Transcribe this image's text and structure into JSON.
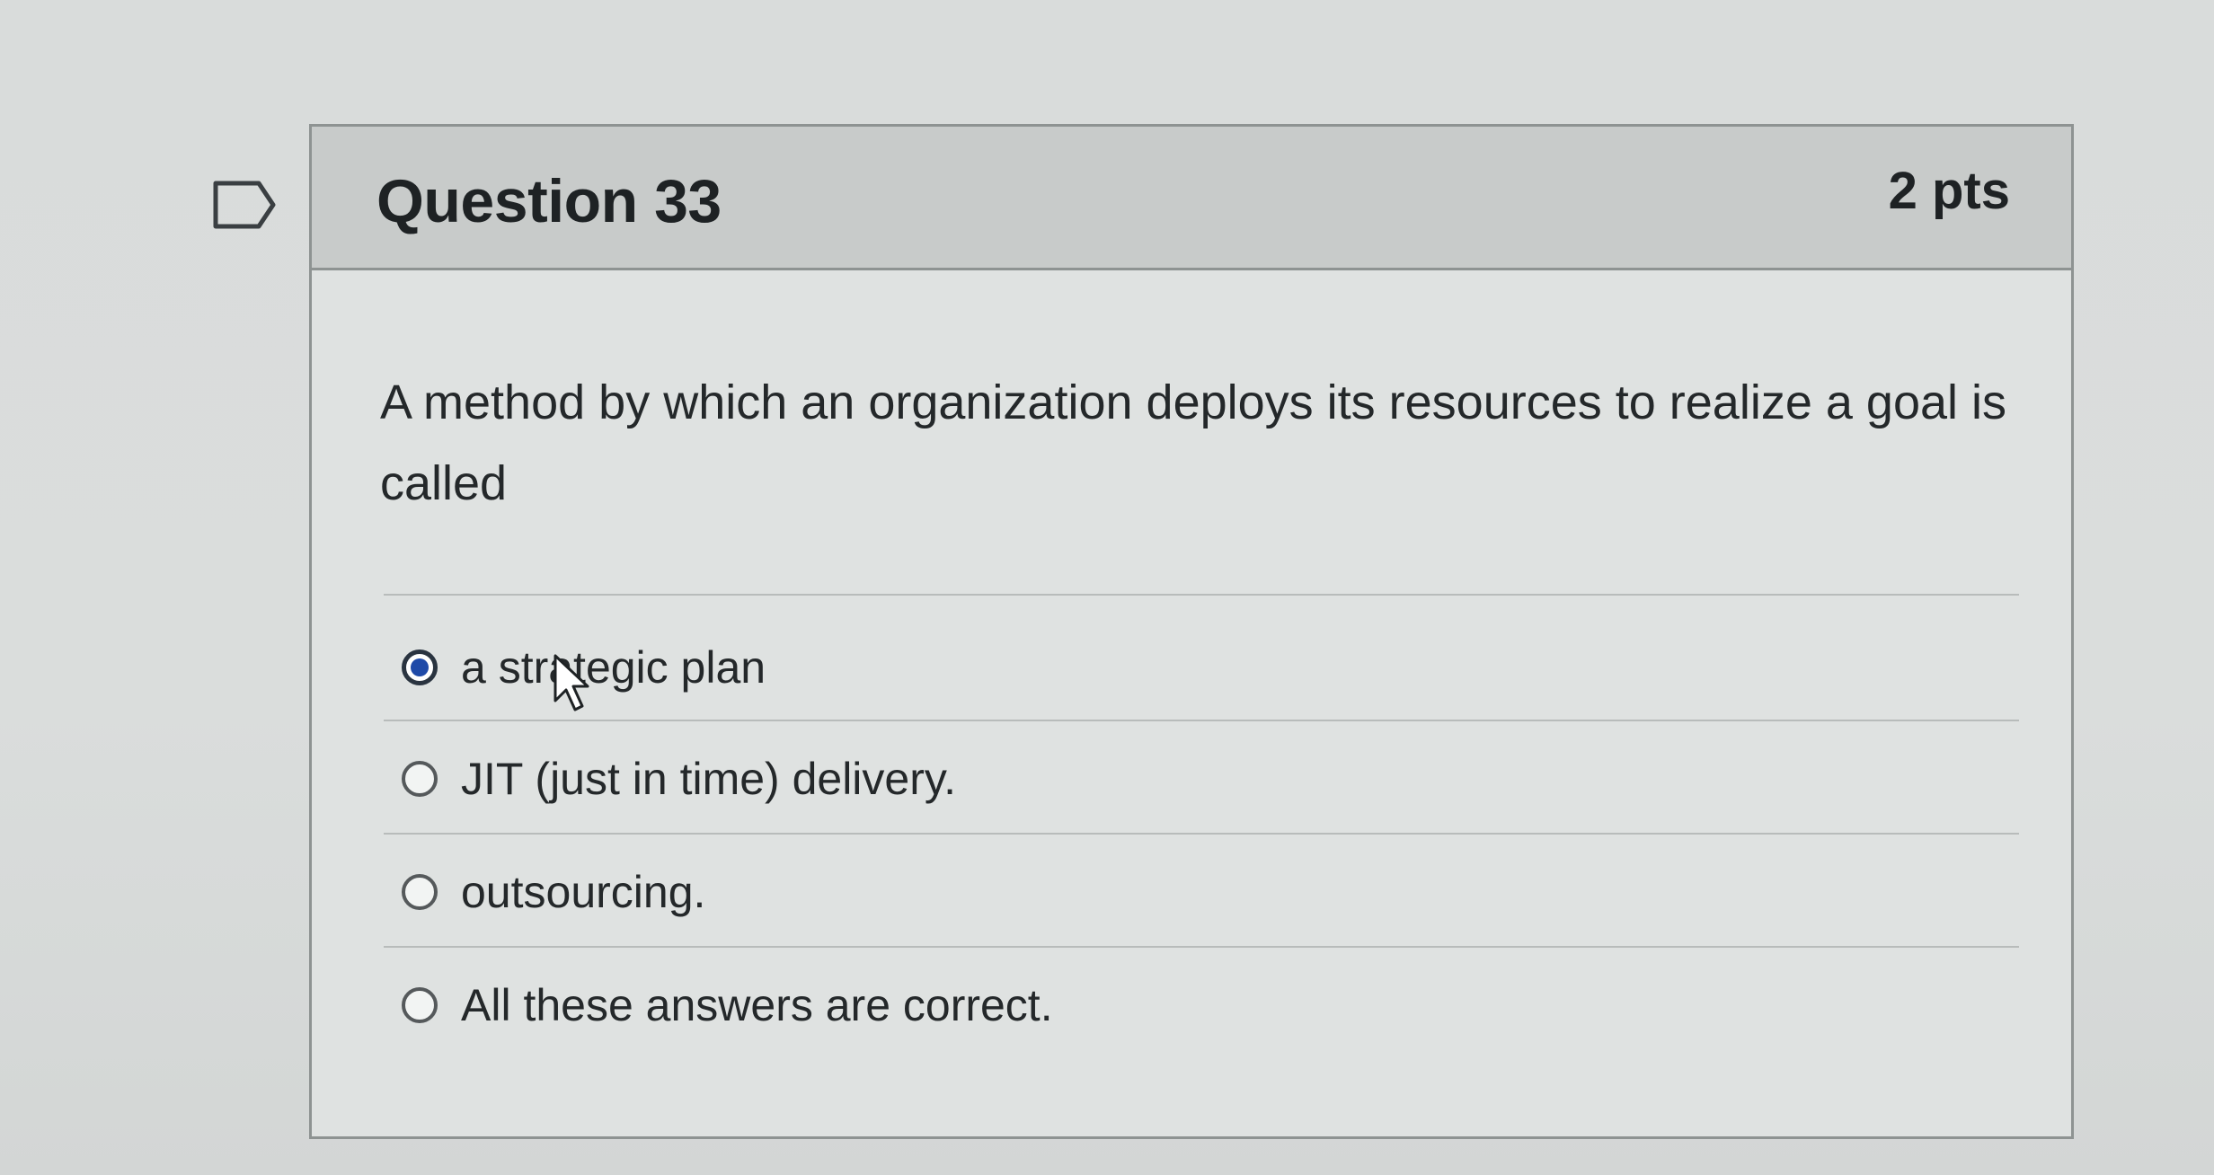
{
  "question": {
    "title": "Question 33",
    "points": "2 pts",
    "text": "A method by which an organization deploys its resources to realize a goal is called",
    "flag_icon": "bookmark-flag-icon"
  },
  "answers": [
    {
      "label": "a strategic plan",
      "selected": true
    },
    {
      "label": "JIT (just in time) delivery.",
      "selected": false
    },
    {
      "label": "outsourcing.",
      "selected": false
    },
    {
      "label": "All these answers are correct.",
      "selected": false
    }
  ],
  "colors": {
    "header_bg": "#c8cbca",
    "card_bg": "#dfe2e1",
    "radio_selected": "#1f4aa8",
    "text": "#24282a"
  }
}
